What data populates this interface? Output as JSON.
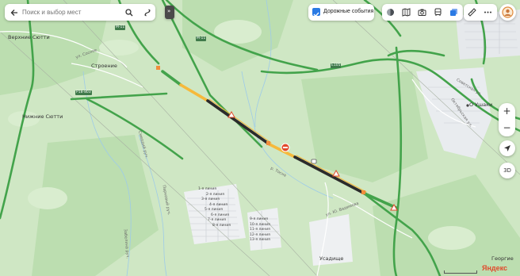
{
  "search": {
    "placeholder": "Поиск и выбор мест"
  },
  "collapse_label": "»",
  "traffic": {
    "label": "Дорожные события",
    "checked": true
  },
  "controls": {
    "zoom_in": "+",
    "zoom_out": "−",
    "three_d": "3D"
  },
  "branding": {
    "logo": "Яндекс"
  },
  "places": {
    "verkhnie": "Верхние Сютти",
    "nizhnie": "Нижние Сютти",
    "stroenie": "Строение",
    "ushaki": "О Ушаки",
    "ussadishe": "Усадище",
    "georgievskoe": "Георгие"
  },
  "roads": {
    "m11a": "М-11",
    "m11b": "М-11",
    "r": "Р-21",
    "e105": "Е105",
    "a120": "Р18-803",
    "sovetskaya": "Советская ул.",
    "oktyabrskaya": "Октябрьская ул.",
    "ul_sosnoe": "ул. Сосное",
    "pr_sosnovaya": "р. Тосна",
    "lugovaya": "Лугов",
    "smerdyi": "Смердий руч.",
    "zabelinoe": "Забелина руч.",
    "parkovy": "Парковый руч.",
    "ul_vadimova": "ул. Ю. Вадимова",
    "r_tosna": "р. Тосна",
    "ul_lesnaya": "ул. Лесная"
  },
  "streets": [
    "1-я линия",
    "2-я линия",
    "3-я линия",
    "4-я линия",
    "5-я линия",
    "6-я линия",
    "7-я линия",
    "8-я линия",
    "9-я линия",
    "10-я линия",
    "11-я линия",
    "12-я линия",
    "13-я линия"
  ],
  "colors": {
    "background": "#cfe7c4",
    "forest": "#bfdfb3",
    "congestion_free": "#43a34b",
    "congestion_slow": "#f6b93b",
    "congestion_jam": "#2b2b2b",
    "road_closed": "#e14a2b",
    "water": "#9ecbe8",
    "accent": "#2a7ae4"
  }
}
